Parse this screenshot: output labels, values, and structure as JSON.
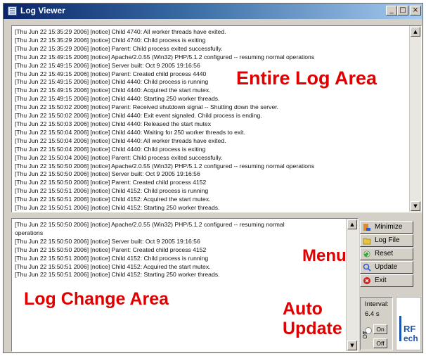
{
  "window": {
    "title": "Log Viewer",
    "controls": {
      "minimize": "_",
      "maximize": "□",
      "close": "×"
    }
  },
  "entire_log": {
    "lines": [
      "[Thu Jun 22 15:35:29 2006] [notice] Child 4740: All worker threads have exited.",
      "[Thu Jun 22 15:35:29 2006] [notice] Child 4740: Child process is exiting",
      "[Thu Jun 22 15:35:29 2006] [notice] Parent: Child process exited successfully.",
      "[Thu Jun 22 15:49:15 2006] [notice] Apache/2.0.55 (Win32) PHP/5.1.2 configured -- resuming normal operations",
      "[Thu Jun 22 15:49:15 2006] [notice] Server built: Oct  9 2005 19:16:56",
      "[Thu Jun 22 15:49:15 2006] [notice] Parent: Created child process 4440",
      "[Thu Jun 22 15:49:15 2006] [notice] Child 4440: Child process is running",
      "[Thu Jun 22 15:49:15 2006] [notice] Child 4440: Acquired the start mutex.",
      "[Thu Jun 22 15:49:15 2006] [notice] Child 4440: Starting 250 worker threads.",
      "[Thu Jun 22 15:50:02 2006] [notice] Parent: Received shutdown signal -- Shutting down the server.",
      "[Thu Jun 22 15:50:02 2006] [notice] Child 4440: Exit event signaled. Child process is ending.",
      "[Thu Jun 22 15:50:03 2006] [notice] Child 4440: Released the start mutex",
      "[Thu Jun 22 15:50:04 2006] [notice] Child 4440: Waiting for 250 worker threads to exit.",
      "[Thu Jun 22 15:50:04 2006] [notice] Child 4440: All worker threads have exited.",
      "[Thu Jun 22 15:50:04 2006] [notice] Child 4440: Child process is exiting",
      "[Thu Jun 22 15:50:04 2006] [notice] Parent: Child process exited successfully.",
      "[Thu Jun 22 15:50:50 2006] [notice] Apache/2.0.55 (Win32) PHP/5.1.2 configured -- resuming normal operations",
      "[Thu Jun 22 15:50:50 2006] [notice] Server built: Oct  9 2005 19:16:56",
      "[Thu Jun 22 15:50:50 2006] [notice] Parent: Created child process 4152",
      "[Thu Jun 22 15:50:51 2006] [notice] Child 4152: Child process is running",
      "[Thu Jun 22 15:50:51 2006] [notice] Child 4152: Acquired the start mutex.",
      "[Thu Jun 22 15:50:51 2006] [notice] Child 4152: Starting 250 worker threads."
    ]
  },
  "change_log": {
    "lines": [
      "[Thu Jun 22 15:50:50 2006] [notice] Apache/2.0.55 (Win32) PHP/5.1.2 configured -- resuming normal",
      "operations",
      "[Thu Jun 22 15:50:50 2006] [notice] Server built: Oct  9 2005 19:16:56",
      "[Thu Jun 22 15:50:50 2006] [notice] Parent: Created child process 4152",
      "[Thu Jun 22 15:50:51 2006] [notice] Child 4152: Child process is running",
      "[Thu Jun 22 15:50:51 2006] [notice] Child 4152: Acquired the start mutex.",
      "[Thu Jun 22 15:50:51 2006] [notice] Child 4152: Starting 250 worker threads."
    ]
  },
  "menu": {
    "buttons": [
      {
        "label": "Minimize",
        "icon": "minimize-icon"
      },
      {
        "label": "Log File",
        "icon": "log-file-icon"
      },
      {
        "label": "Reset",
        "icon": "reset-icon"
      },
      {
        "label": "Update",
        "icon": "update-icon"
      },
      {
        "label": "Exit",
        "icon": "exit-icon"
      }
    ]
  },
  "auto_update": {
    "interval_label": "Interval:",
    "interval_value": "6.4 s",
    "on_label": "On",
    "off_label": "Off",
    "vertical_label": "Off"
  },
  "annotations": {
    "entire_log": "Entire Log Area",
    "log_change": "Log Change Area",
    "menu": "Menu",
    "auto": "Auto",
    "update": "Update"
  },
  "logo": {
    "line1": "RF",
    "line2": "ech"
  },
  "colors": {
    "annotation": "#e00000",
    "title_bar": "#0a246a",
    "logo": "#1a55b5"
  }
}
